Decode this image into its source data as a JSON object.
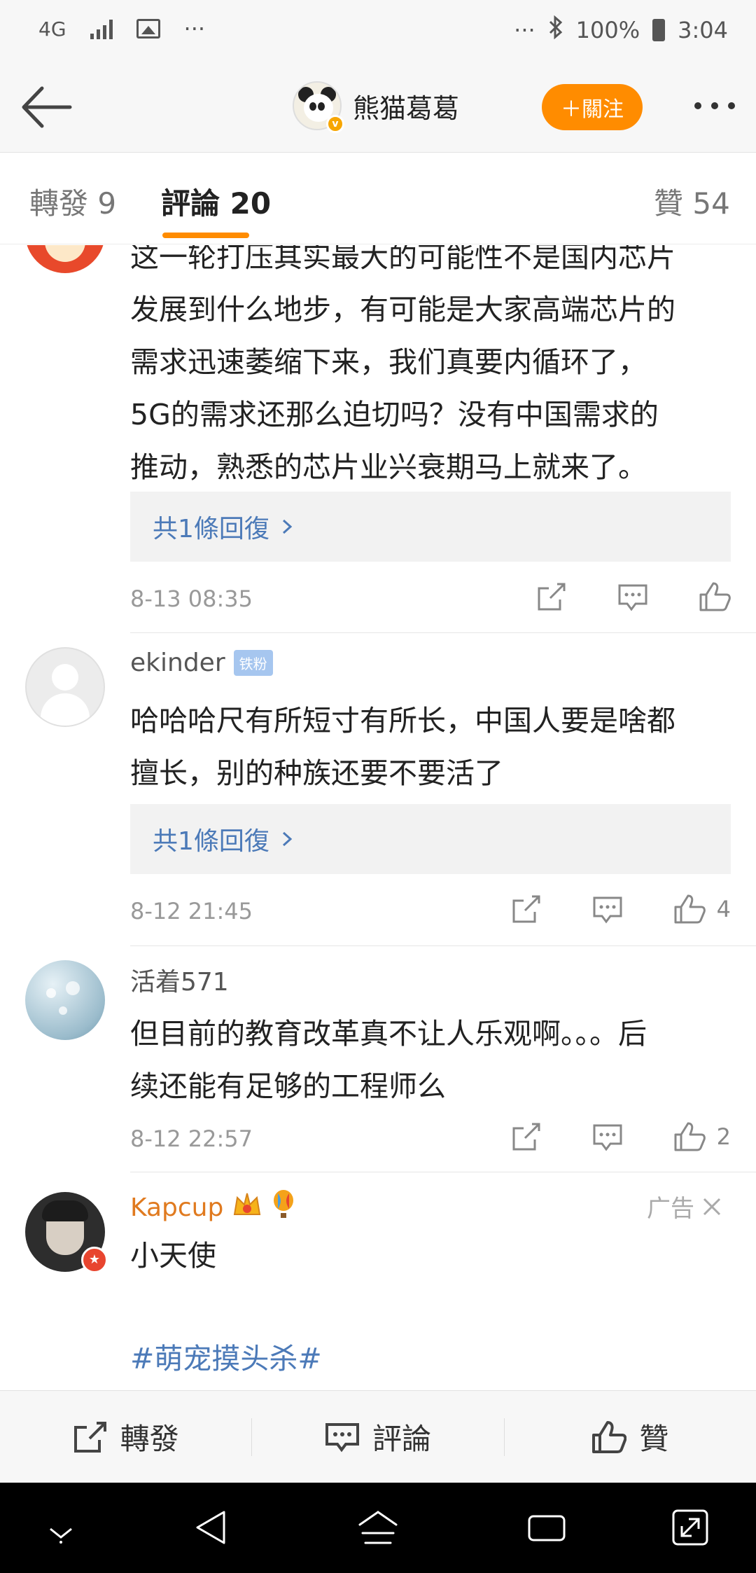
{
  "status_bar": {
    "network": "4G",
    "more": "···",
    "right_more": "···",
    "battery": "100%",
    "time": "3:04"
  },
  "header": {
    "title": "熊猫葛葛",
    "follow_label": "＋關注"
  },
  "tabs": {
    "repost": "轉發 9",
    "comments": "評論 20",
    "likes": "贊 54"
  },
  "comments": [
    {
      "text_lines": [
        "这一轮打压其实最大的可能性不是国内芯片",
        "发展到什么地步，有可能是大家高端芯片的",
        "需求迅速萎缩下来，我们真要内循环了，",
        "5G的需求还那么迫切吗？没有中国需求的",
        "推动，熟悉的芯片业兴衰期马上就来了。"
      ],
      "replies": "共1條回復",
      "time": "8-13 08:35",
      "likes": ""
    },
    {
      "user": "ekinder",
      "badge": "铁粉",
      "text_lines": [
        "哈哈哈尺有所短寸有所长，中国人要是啥都",
        "擅长，别的种族还要不要活了"
      ],
      "replies": "共1條回復",
      "time": "8-12 21:45",
      "likes": "4"
    },
    {
      "user": "活着571",
      "text_lines": [
        "但目前的教育改革真不让人乐观啊。。。后",
        "续还能有足够的工程师么"
      ],
      "time": "8-12 22:57",
      "likes": "2"
    },
    {
      "user": "Kapcup",
      "ad_label": "广告",
      "text": "小天使",
      "hashtag": "#萌宠摸头杀#"
    }
  ],
  "bottom_bar": {
    "repost": "轉發",
    "comment": "評論",
    "like": "贊"
  },
  "colors": {
    "accent": "#ff8c00",
    "link": "#4c7ab8",
    "ad_user": "#e07a1f"
  }
}
